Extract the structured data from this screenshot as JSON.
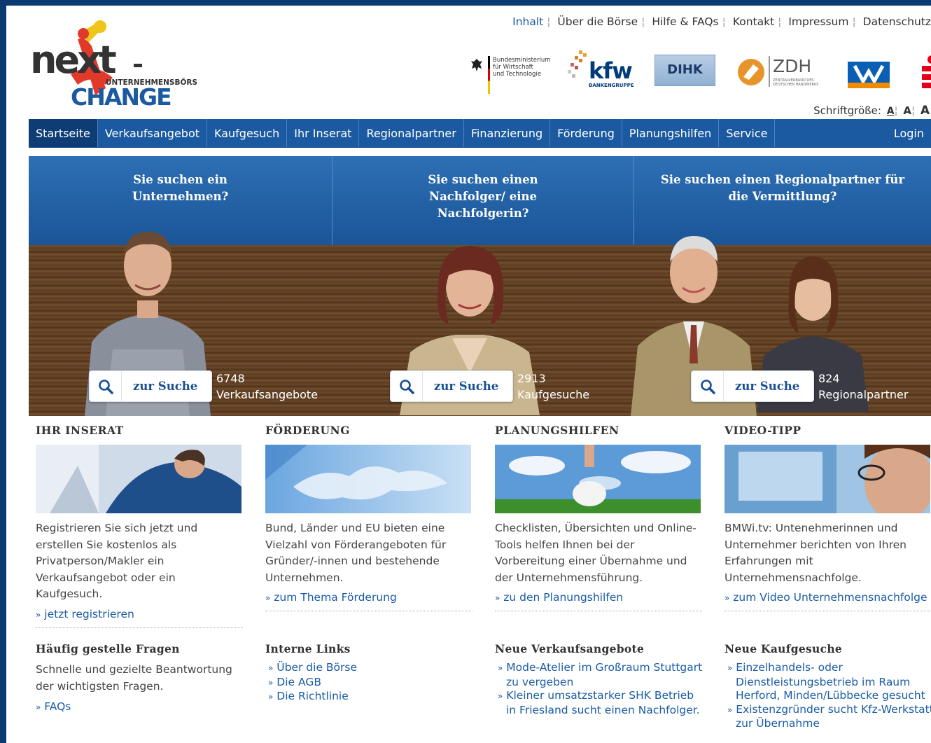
{
  "logo": {
    "alt": "nexxt-change Unternehmensbörse",
    "word_top": "next",
    "word_bottom": "CHANGE",
    "tagline": "UNTERNEHMENSBÖRSE"
  },
  "toplinks": [
    "Inhalt",
    "Über die Börse",
    "Hilfe & FAQs",
    "Kontakt",
    "Impressum",
    "Datenschutz"
  ],
  "sponsors": {
    "bmwi": [
      "Bundesministerium",
      "für Wirtschaft",
      "und Technologie"
    ],
    "kfw": "kfw",
    "kfw_sub": "BANKENGRUPPE",
    "dihk": "DIHK",
    "zdh": "ZDH",
    "zdh_sub": "ZENTRALVERBAND DES DEUTSCHEN HANDWERKS"
  },
  "fontsize": {
    "label": "Schriftgröße:",
    "small": "A",
    "medium": "A",
    "large": "A"
  },
  "nav": {
    "items": [
      "Startseite",
      "Verkaufsangebot",
      "Kaufgesuch",
      "Ihr Inserat",
      "Regionalpartner",
      "Finanzierung",
      "Förderung",
      "Planungshilfen",
      "Service"
    ],
    "login": "Login"
  },
  "hero": {
    "questions": [
      "Sie suchen ein Unternehmen?",
      "Sie suchen einen Nachfolger/ eine Nachfolgerin?",
      "Sie suchen einen Regionalpartner für die Vermittlung?"
    ],
    "search_label": "zur Suche",
    "counts": [
      {
        "number": "6748",
        "label": "Verkaufsangebote"
      },
      {
        "number": "2913",
        "label": "Kaufgesuche"
      },
      {
        "number": "824",
        "label": "Regionalpartner"
      }
    ]
  },
  "columns": [
    {
      "title": "IHR INSERAT",
      "text": "Registrieren Sie sich jetzt und erstellen Sie kostenlos als Privatperson/Makler ein Verkaufsangebot oder ein Kaufgesuch.",
      "link": "jetzt registrieren"
    },
    {
      "title": "FÖRDERUNG",
      "text": "Bund, Länder und EU bieten eine Vielzahl von Förderangeboten für Gründer/-innen und bestehende Unternehmen.",
      "link": "zum Thema Förderung"
    },
    {
      "title": "PLANUNGSHILFEN",
      "text": "Checklisten, Übersichten und Online-Tools helfen Ihnen bei der Vorbereitung einer Übernahme und der Unternehmensführung.",
      "link": "zu den Planungshilfen"
    },
    {
      "title": "VIDEO-TIPP",
      "text": "BMWi.tv: Untenehmerinnen und Unternehmer berichten von Ihren Erfahrungen mit Unternehmensnachfolge.",
      "link": "zum Video Unternehmensnachfolge"
    }
  ],
  "faq": {
    "title": "Häufig gestelle Fragen",
    "text": "Schnelle und gezielte Beantwortung der wichtigsten Fragen.",
    "link": "FAQs"
  },
  "internal": {
    "title": "Interne Links",
    "links": [
      "Über die Börse",
      "Die AGB",
      "Die Richtlinie"
    ]
  },
  "new_offers": {
    "title": "Neue Verkaufsangebote",
    "links": [
      "Mode-Atelier im Großraum Stuttgart zu vergeben",
      "Kleiner umsatzstarker SHK Betrieb in Friesland sucht einen Nachfolger."
    ]
  },
  "new_requests": {
    "title": "Neue Kaufgesuche",
    "links": [
      "Einzelhandels- oder Dienstleistungsbetrieb im Raum Herford, Minden/Lübbecke gesucht",
      "Existenzgründer sucht Kfz-Werkstatt zur Übernahme"
    ]
  },
  "colors": {
    "page_bg": "#0b3a73",
    "nav": "#1b5aa0",
    "nav_active": "#0e3d76",
    "link": "#1a5ba6"
  }
}
